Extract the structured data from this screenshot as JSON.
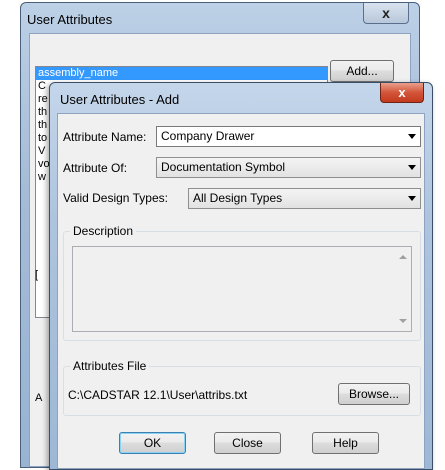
{
  "back_dialog": {
    "title": "User Attributes",
    "close_glyph": "x",
    "list_items": [
      "assembly_name",
      "C",
      "re",
      "th",
      "th",
      "to",
      "V",
      "vo",
      "w"
    ],
    "add_button": "Add...",
    "frag_left_1": "[",
    "frag_left_2": "A"
  },
  "dialog": {
    "title": "User Attributes - Add",
    "close_glyph": "x",
    "attribute_name_label": "Attribute Name:",
    "attribute_name_value": "Company Drawer",
    "attribute_of_label": "Attribute Of:",
    "attribute_of_value": "Documentation Symbol",
    "design_types_label": "Valid Design Types:",
    "design_types_value": "All Design Types",
    "description_label": "Description",
    "description_value": "",
    "attributes_file_label": "Attributes File",
    "attributes_file_path": "C:\\CADSTAR 12.1\\User\\attribs.txt",
    "browse_button": "Browse...",
    "ok_button": "OK",
    "close_button": "Close",
    "help_button": "Help"
  },
  "icons": {
    "dropdown": "chevron-down-icon",
    "close": "close-icon"
  }
}
